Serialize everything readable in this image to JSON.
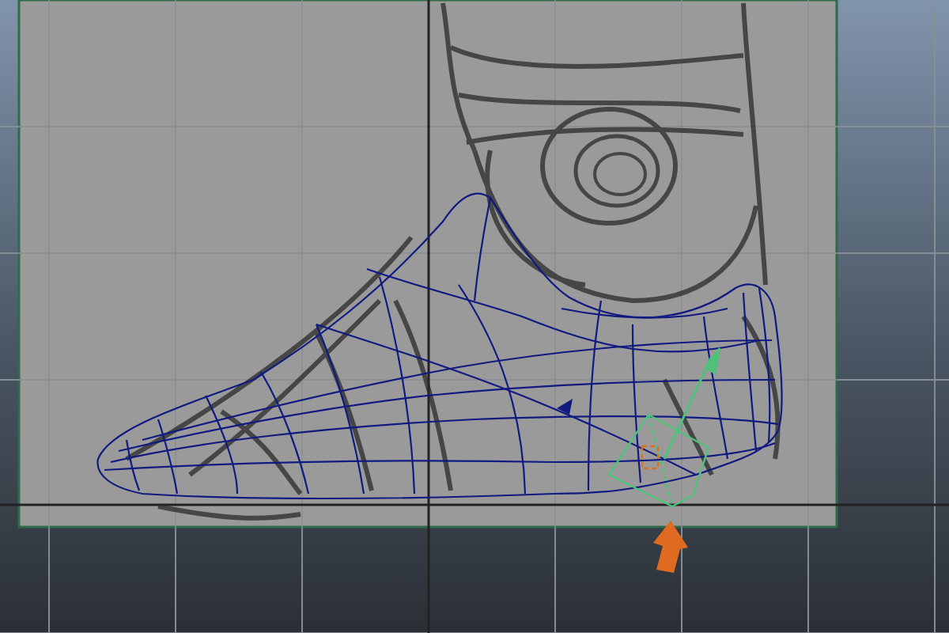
{
  "scene": {
    "objects": [
      {
        "kind": "image_plane"
      },
      {
        "kind": "sketch"
      },
      {
        "kind": "wireframe"
      },
      {
        "kind": "manipulator"
      },
      {
        "kind": "arrow"
      }
    ]
  }
}
